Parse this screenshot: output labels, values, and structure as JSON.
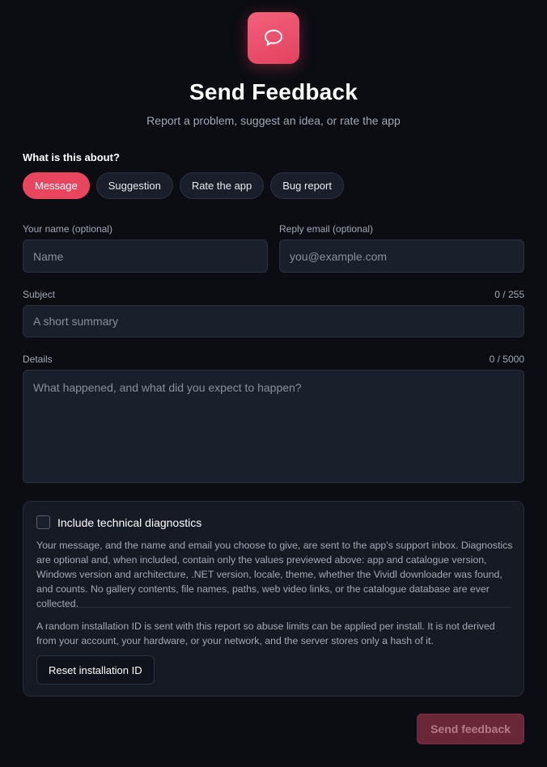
{
  "header": {
    "logo_icon": "speech-bubble-icon",
    "title": "Send Feedback",
    "subtitle": "Report a problem, suggest an idea, or rate the app"
  },
  "category": {
    "label": "What is this about?",
    "options": [
      "Message",
      "Suggestion",
      "Rate the app",
      "Bug report"
    ],
    "selected": "Message"
  },
  "name_field": {
    "label": "Your name (optional)",
    "value": "",
    "placeholder": "Name"
  },
  "email_field": {
    "label": "Reply email (optional)",
    "value": "",
    "placeholder": "you@example.com"
  },
  "subject_field": {
    "label": "Subject",
    "counter": "0 / 255",
    "value": "",
    "placeholder": "A short summary"
  },
  "details_field": {
    "label": "Details",
    "counter": "0 / 5000",
    "value": "",
    "placeholder": "What happened, and what did you expect to happen?"
  },
  "diagnostics": {
    "checkbox_label": "Include technical diagnostics",
    "checked": false,
    "description": "Your message, and the name and email you choose to give, are sent to the app's support inbox. Diagnostics are optional and, when included, contain only the values previewed above: app and catalogue version, Windows version and architecture, .NET version, locale, theme, whether the Vividl downloader was found, and counts. No gallery contents, file names, paths, web video links, or the catalogue database are ever collected.",
    "installation_note": "A random installation ID is sent with this report so abuse limits can be applied per install. It is not derived from your account, your hardware, or your network, and the server stores only a hash of it.",
    "reset_label": "Reset installation ID"
  },
  "submit": {
    "label": "Send feedback",
    "enabled": false
  },
  "colors": {
    "accent": "#e8455f",
    "background": "#0b0d12",
    "panel": "#161a25"
  }
}
